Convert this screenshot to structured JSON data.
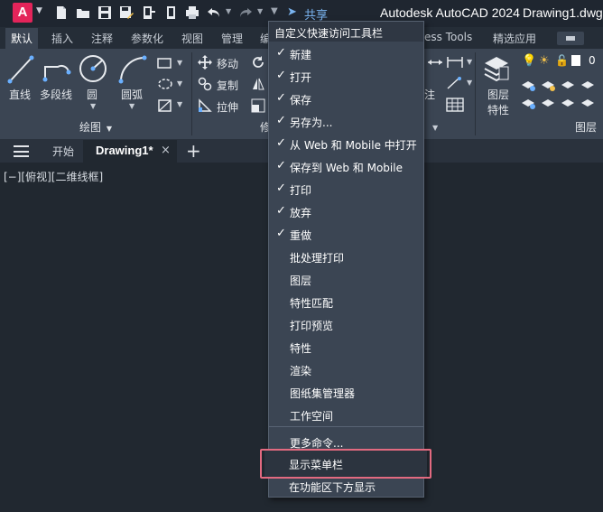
{
  "window": {
    "app_title": "Autodesk AutoCAD 2024",
    "document_title": "Drawing1.dwg",
    "logo_letter": "A",
    "share_label": "共享"
  },
  "quick_access_icons": [
    "new-icon",
    "open-icon",
    "save-icon",
    "save-as-icon",
    "web-mobile-icon",
    "plot-icon",
    "undo-icon",
    "redo-icon",
    "qat-dropdown-icon"
  ],
  "ribbon": {
    "tabs": [
      "默认",
      "插入",
      "注释",
      "参数化",
      "视图",
      "管理",
      "编",
      "ess Tools",
      "精选应用"
    ],
    "active_tab": "默认",
    "draw_tools": [
      "直线",
      "多段线",
      "圆",
      "圆弧"
    ],
    "modify_tools": [
      "移动",
      "复制",
      "拉伸",
      "修"
    ],
    "draw_panel_label": "绘图",
    "annotation_partial": "注",
    "layer_tools": [
      "图层",
      "特性"
    ],
    "layer_panel_label": "图层",
    "layer_value": "0"
  },
  "doc_tabs": {
    "start": "开始",
    "active": "Drawing1*",
    "close": "×",
    "add": "+"
  },
  "viewport": {
    "label": "[−][俯视][二维线框]"
  },
  "qat_menu": {
    "title": "自定义快速访问工具栏",
    "items": [
      {
        "label": "新建",
        "checked": true
      },
      {
        "label": "打开",
        "checked": true
      },
      {
        "label": "保存",
        "checked": true
      },
      {
        "label": "另存为...",
        "checked": true
      },
      {
        "label": "从 Web 和 Mobile 中打开",
        "checked": true
      },
      {
        "label": "保存到 Web 和 Mobile",
        "checked": true
      },
      {
        "label": "打印",
        "checked": true
      },
      {
        "label": "放弃",
        "checked": true
      },
      {
        "label": "重做",
        "checked": true
      },
      {
        "label": "批处理打印",
        "checked": false
      },
      {
        "label": "图层",
        "checked": false
      },
      {
        "label": "特性匹配",
        "checked": false
      },
      {
        "label": "打印预览",
        "checked": false
      },
      {
        "label": "特性",
        "checked": false
      },
      {
        "label": "渲染",
        "checked": false
      },
      {
        "label": "图纸集管理器",
        "checked": false
      },
      {
        "label": "工作空间",
        "checked": false
      }
    ],
    "more_commands": "更多命令...",
    "show_menubar": "显示菜单栏",
    "show_below_ribbon": "在功能区下方显示",
    "check_mark": "✓"
  },
  "colors": {
    "accent_share": "#7ab4f0",
    "logo": "#e3245a",
    "highlight_outline": "#e36a80"
  }
}
